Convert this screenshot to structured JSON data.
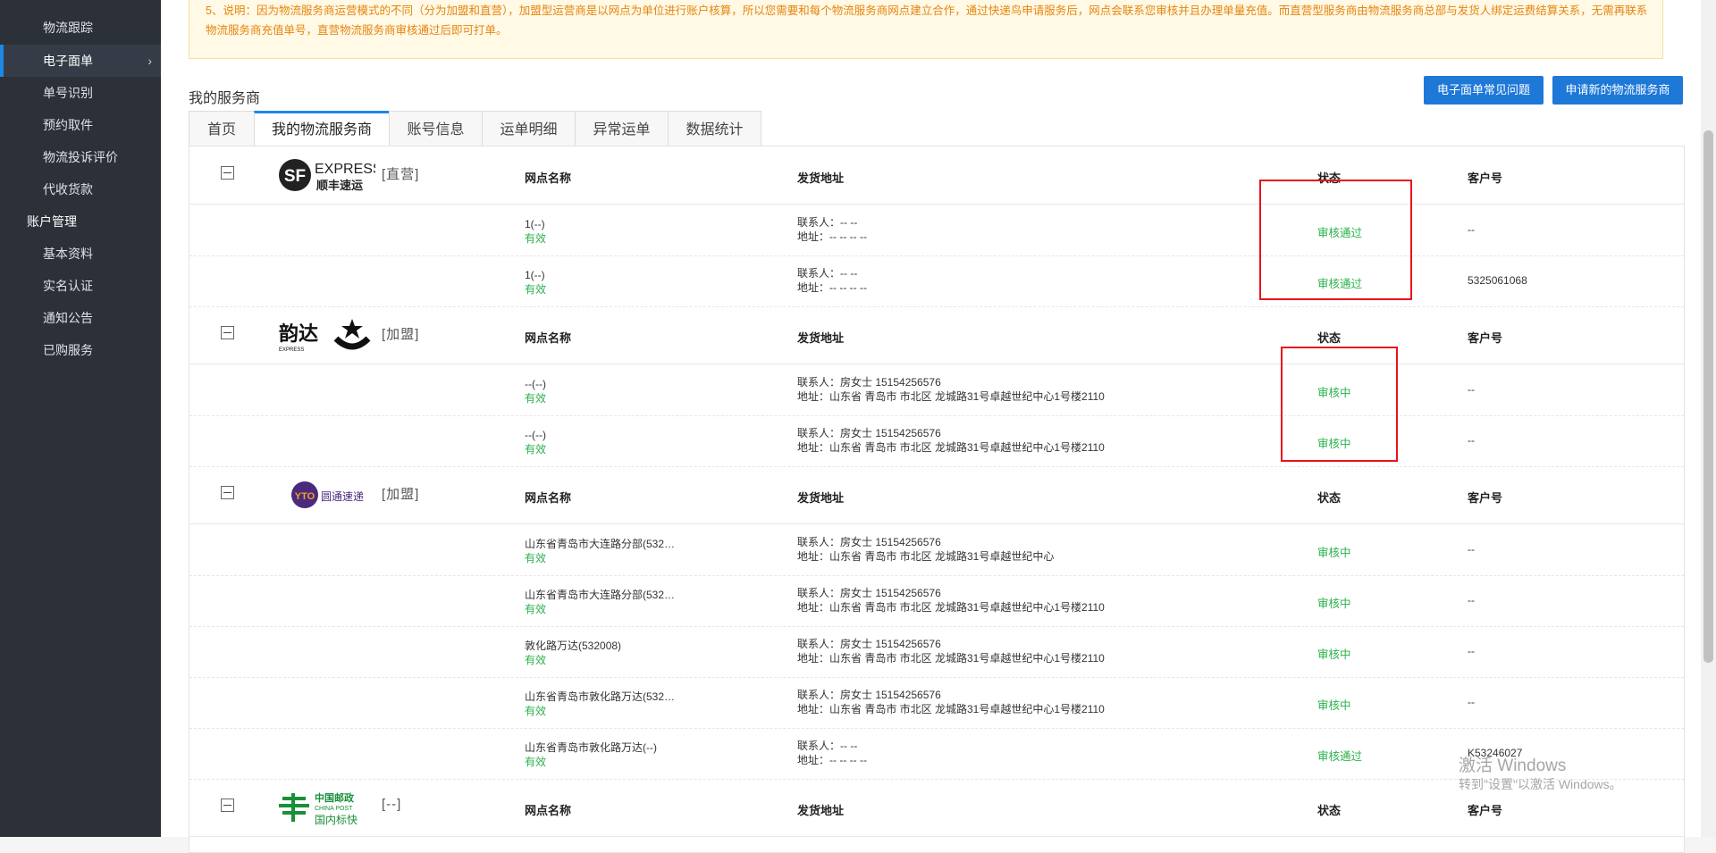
{
  "sidebar": {
    "items": [
      {
        "label": "物流跟踪"
      },
      {
        "label": "电子面单",
        "active": true
      },
      {
        "label": "单号识别"
      },
      {
        "label": "预约取件"
      },
      {
        "label": "物流投诉评价"
      },
      {
        "label": "代收货款"
      }
    ],
    "group_account": "账户管理",
    "account_items": [
      {
        "label": "基本资料"
      },
      {
        "label": "实名认证"
      },
      {
        "label": "通知公告"
      },
      {
        "label": "已购服务"
      }
    ]
  },
  "notice": {
    "text": "5、说明：因为物流服务商运营模式的不同（分为加盟和直营），加盟型运营商是以网点为单位进行账户核算，所以您需要和每个物流服务商网点建立合作，通过快递鸟申请服务后，网点会联系您审核并且办理单量充值。而直营型服务商由物流服务商总部与发货人绑定运费结算关系，无需再联系物流服务商充值单号，直营物流服务商审核通过后即可打单。"
  },
  "section_title": "我的服务商",
  "buttons": {
    "faq": "电子面单常见问题",
    "apply": "申请新的物流服务商"
  },
  "tabs": [
    "首页",
    "我的物流服务商",
    "账号信息",
    "运单明细",
    "异常运单",
    "数据统计"
  ],
  "columns": {
    "name": "网点名称",
    "addr": "发货地址",
    "status": "状态",
    "customer": "客户号"
  },
  "carriers": [
    {
      "logo_text": "EXPRESS",
      "logo_sub": "顺丰速运",
      "logo_letters": "SF",
      "tag": "[直营]",
      "rows": [
        {
          "name": "1(--)",
          "valid": "有效",
          "contact": "联系人：-- --",
          "address": "地址：-- -- -- --",
          "status": "审核通过",
          "customer": "--"
        },
        {
          "name": "1(--)",
          "valid": "有效",
          "contact": "联系人：-- --",
          "address": "地址：-- -- -- --",
          "status": "审核通过",
          "customer": "5325061068"
        }
      ]
    },
    {
      "logo_text": "韵达",
      "logo_sub": "EXPRESS",
      "tag": "[加盟]",
      "rows": [
        {
          "name": "--(--)",
          "valid": "有效",
          "contact": "联系人：房女士 15154256576",
          "address": "地址：山东省 青岛市 市北区 龙城路31号卓越世纪中心1号楼2110",
          "status": "审核中",
          "customer": "--"
        },
        {
          "name": "--(--)",
          "valid": "有效",
          "contact": "联系人：房女士 15154256576",
          "address": "地址：山东省 青岛市 市北区 龙城路31号卓越世纪中心1号楼2110",
          "status": "审核中",
          "customer": "--"
        }
      ]
    },
    {
      "logo_text": "圆通速递",
      "logo_letters": "YTO",
      "tag": "[加盟]",
      "rows": [
        {
          "name": "山东省青岛市大连路分部(532…",
          "valid": "有效",
          "contact": "联系人：房女士 15154256576",
          "address": "地址：山东省 青岛市 市北区 龙城路31号卓越世纪中心",
          "status": "审核中",
          "customer": "--"
        },
        {
          "name": "山东省青岛市大连路分部(532…",
          "valid": "有效",
          "contact": "联系人：房女士 15154256576",
          "address": "地址：山东省 青岛市 市北区 龙城路31号卓越世纪中心1号楼2110",
          "status": "审核中",
          "customer": "--"
        },
        {
          "name": "敦化路万达(532008)",
          "valid": "有效",
          "contact": "联系人：房女士 15154256576",
          "address": "地址：山东省 青岛市 市北区 龙城路31号卓越世纪中心1号楼2110",
          "status": "审核中",
          "customer": "--"
        },
        {
          "name": "山东省青岛市敦化路万达(532…",
          "valid": "有效",
          "contact": "联系人：房女士 15154256576",
          "address": "地址：山东省 青岛市 市北区 龙城路31号卓越世纪中心1号楼2110",
          "status": "审核中",
          "customer": "--"
        },
        {
          "name": "山东省青岛市敦化路万达(--)",
          "valid": "有效",
          "contact": "联系人：-- --",
          "address": "地址：-- -- -- --",
          "status": "审核通过",
          "customer": "K53246027"
        }
      ]
    },
    {
      "logo_text": "中国邮政",
      "logo_sub": "CHINA POST",
      "logo_sub2": "国内标快",
      "tag": "[--]",
      "rows": []
    }
  ],
  "watermark": {
    "line1": "激活 Windows",
    "line2": "转到\"设置\"以激活 Windows。"
  },
  "colors": {
    "sidebar_bg": "#2b3039",
    "accent": "#1e78d7",
    "status_green": "#2bb24c",
    "highlight_red": "#e8141b",
    "notice_text": "#e6850e"
  }
}
